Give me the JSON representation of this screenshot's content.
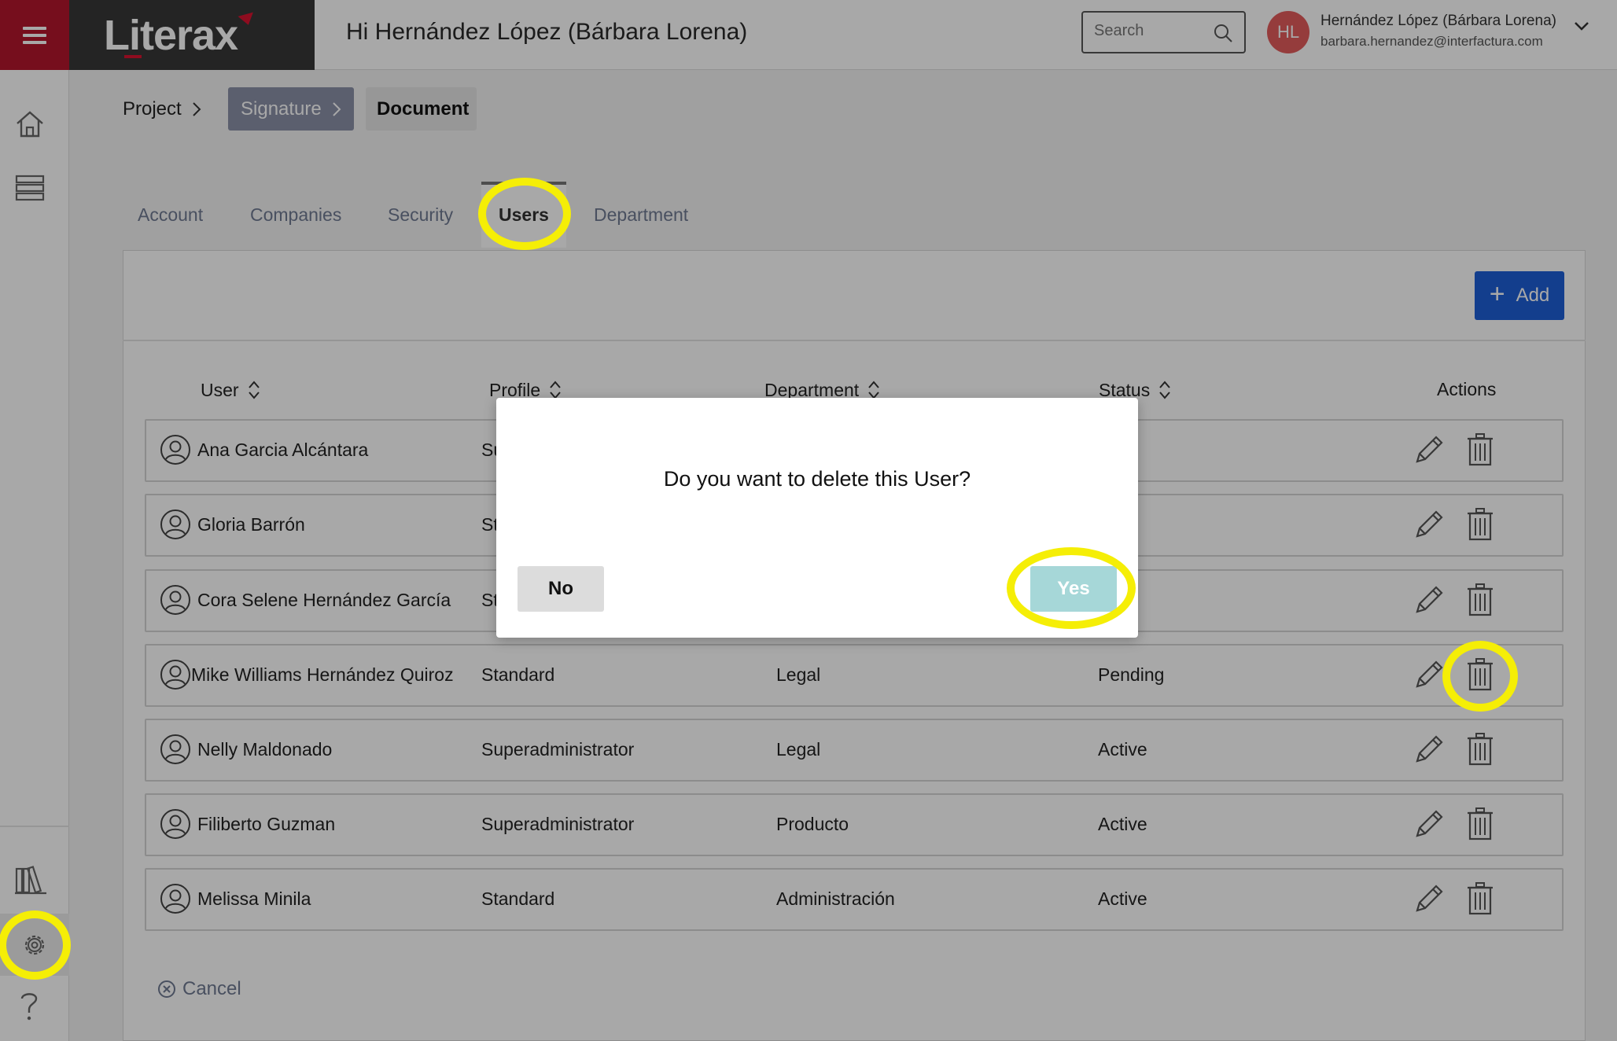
{
  "header": {
    "brand": "Literax",
    "greeting": "Hi Hernández López (Bárbara Lorena)",
    "search_placeholder": "Search",
    "avatar_initials": "HL",
    "user_name": "Hernández López (Bárbara Lorena)",
    "user_email": "barbara.hernandez@interfactura.com"
  },
  "breadcrumb": {
    "project": "Project",
    "signature": "Signature",
    "document": "Document"
  },
  "tabs": {
    "account": "Account",
    "companies": "Companies",
    "security": "Security",
    "users": "Users",
    "department": "Department"
  },
  "toolbar": {
    "add_label": "Add"
  },
  "table": {
    "headers": {
      "user": "User",
      "profile": "Profile",
      "department": "Department",
      "status": "Status",
      "actions": "Actions"
    },
    "rows": [
      {
        "user": "Ana Garcia Alcántara",
        "profile": "Su",
        "department": "",
        "status": "e"
      },
      {
        "user": "Gloria Barrón",
        "profile": "St",
        "department": "",
        "status": "e"
      },
      {
        "user": "Cora Selene Hernández García",
        "profile": "St",
        "department": "",
        "status": "e"
      },
      {
        "user": "Mike Williams Hernández Quiroz",
        "profile": "Standard",
        "department": "Legal",
        "status": "Pending"
      },
      {
        "user": "Nelly Maldonado",
        "profile": "Superadministrator",
        "department": "Legal",
        "status": "Active"
      },
      {
        "user": "Filiberto Guzman",
        "profile": "Superadministrator",
        "department": "Producto",
        "status": "Active"
      },
      {
        "user": "Melissa Minila",
        "profile": "Standard",
        "department": "Administración",
        "status": "Active"
      }
    ]
  },
  "footer": {
    "cancel_label": "Cancel"
  },
  "dialog": {
    "message": "Do you want to delete this User?",
    "no_label": "No",
    "yes_label": "Yes"
  },
  "colors": {
    "brand_red": "#b3162d",
    "primary_blue": "#1e5ed6",
    "highlight": "#f5ee06",
    "yes_button": "#a6d7d8"
  }
}
